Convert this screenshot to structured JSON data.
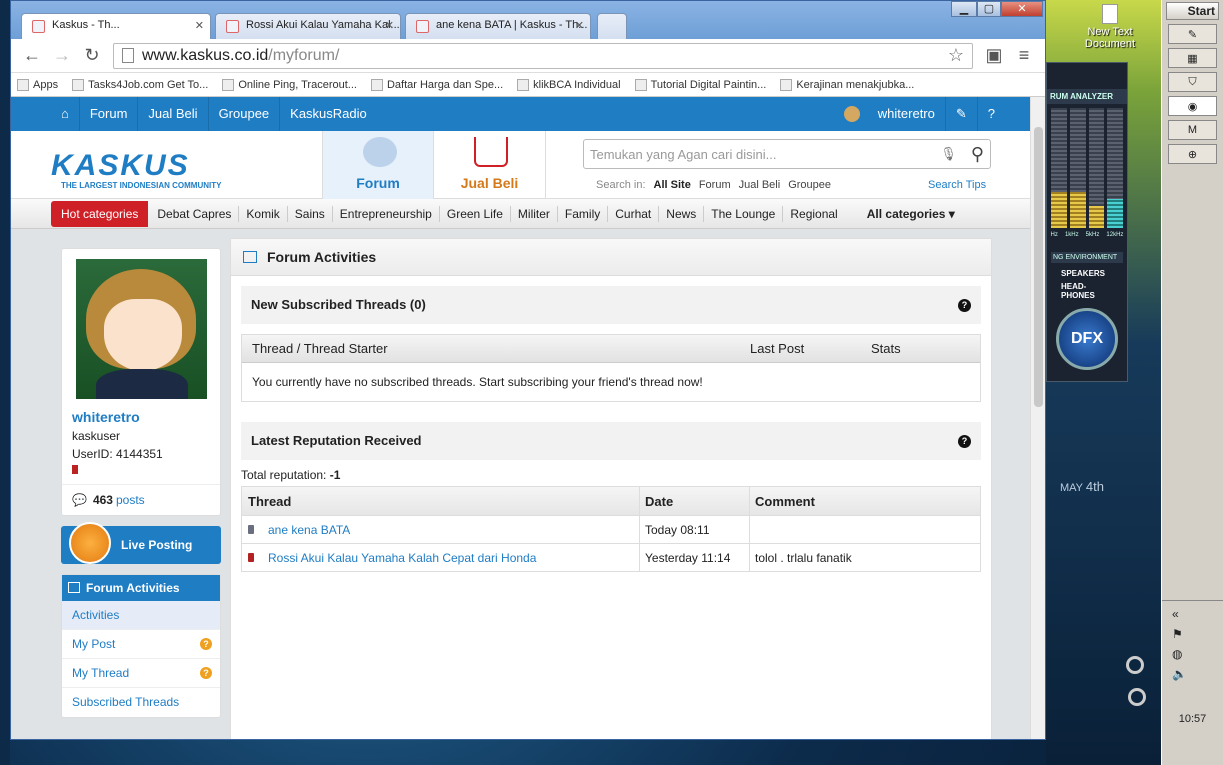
{
  "desktop": {
    "icon_label": "New Text Document",
    "analyzer_title": "RUM ANALYZER",
    "freqs": [
      "Hz",
      "1kHz",
      "5kHz",
      "12kHz"
    ],
    "env_label": "NG ENVIRONMENT",
    "speakers": "SPEAKERS",
    "headphones": "HEAD-PHONES",
    "dfx": "DFX",
    "month": "MAY",
    "day": "4th"
  },
  "taskbar": {
    "start": "Start",
    "clock": "10:57",
    "expand": "«"
  },
  "browser": {
    "tabs": [
      {
        "title": "Kaskus - Th..."
      },
      {
        "title": "Rossi Akui Kalau Yamaha Kal..."
      },
      {
        "title": "ane kena BATA | Kaskus - Th..."
      }
    ],
    "url_host": "www.kaskus.co.id",
    "url_path": "/myforum/",
    "bookmarks": [
      "Apps",
      "Tasks4Job.com Get To...",
      "Online Ping, Tracerout...",
      "Daftar Harga dan Spe...",
      "klikBCA Individual",
      "Tutorial Digital Paintin...",
      "Kerajinan menakjubka..."
    ]
  },
  "topnav": {
    "items": [
      "Forum",
      "Jual Beli",
      "Groupee",
      "KaskusRadio"
    ],
    "username": "whiteretro"
  },
  "header": {
    "logo": "KASKUS",
    "logo_sub": "THE LARGEST INDONESIAN COMMUNITY",
    "tab_forum": "Forum",
    "tab_jualbeli": "Jual Beli",
    "search_placeholder": "Temukan yang Agan cari disini...",
    "search_in_label": "Search in:",
    "search_options": [
      "All Site",
      "Forum",
      "Jual Beli",
      "Groupee"
    ],
    "search_tips": "Search Tips"
  },
  "categories": {
    "hot": "Hot categories",
    "items": [
      "Debat Capres",
      "Komik",
      "Sains",
      "Entrepreneurship",
      "Green Life",
      "Militer",
      "Family",
      "Curhat",
      "News",
      "The Lounge",
      "Regional"
    ],
    "all": "All categories ▾"
  },
  "profile": {
    "name": "whiteretro",
    "role": "kaskuser",
    "userid": "UserID: 4144351",
    "posts_count": "463",
    "posts_label": "posts"
  },
  "live_posting": "Live Posting",
  "forum_activities": {
    "title": "Forum Activities",
    "items": [
      "Activities",
      "My Post",
      "My Thread",
      "Subscribed Threads"
    ]
  },
  "main": {
    "title": "Forum Activities",
    "subscribed_title": "New Subscribed Threads (0)",
    "sub_cols": [
      "Thread / Thread Starter",
      "Last Post",
      "Stats"
    ],
    "sub_empty": "You currently have no subscribed threads. Start subscribing your friend's thread now!",
    "rep_title": "Latest Reputation Received",
    "total_rep_label": "Total reputation:",
    "total_rep_value": "-1",
    "rep_cols": [
      "Thread",
      "Date",
      "Comment"
    ],
    "rep_rows": [
      {
        "thread": "ane kena BATA",
        "date": "Today 08:11",
        "comment": "",
        "color": "#6a6f80"
      },
      {
        "thread": "Rossi Akui Kalau Yamaha Kalah Cepat dari Honda",
        "date": "Yesterday 11:14",
        "comment": "tolol . trlalu fanatik",
        "color": "#b22222"
      }
    ]
  }
}
